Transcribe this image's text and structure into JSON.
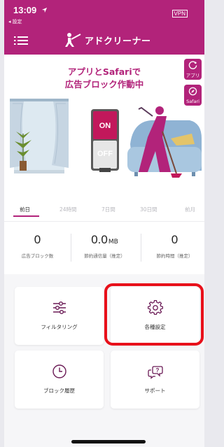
{
  "status": {
    "time": "13:09",
    "back_label": "◂ 設定",
    "vpn": "VPN"
  },
  "header": {
    "logo_text": "アドクリーナー"
  },
  "hero": {
    "headline_line1": "アプリとSafariで",
    "headline_line2": "広告ブロック作動中",
    "toggle_on": "ON",
    "toggle_off": "OFF",
    "side_buttons": [
      {
        "label": "アプリ",
        "icon": "app-icon"
      },
      {
        "label": "Safari",
        "icon": "safari-compass-icon"
      }
    ]
  },
  "tabs": [
    {
      "label": "前日",
      "active": true
    },
    {
      "label": "24時間",
      "active": false
    },
    {
      "label": "7日間",
      "active": false
    },
    {
      "label": "30日間",
      "active": false
    },
    {
      "label": "前月",
      "active": false
    }
  ],
  "stats": [
    {
      "value": "0",
      "unit": "",
      "label": "広告ブロック数"
    },
    {
      "value": "0.0",
      "unit": "MB",
      "label": "節約通信量（推定）"
    },
    {
      "value": "0",
      "unit": "",
      "label": "節約時間（推定）"
    }
  ],
  "cards": [
    {
      "label": "フィルタリング",
      "icon": "sliders-icon"
    },
    {
      "label": "各種設定",
      "icon": "gear-icon"
    },
    {
      "label": "ブロック履歴",
      "icon": "clock-icon"
    },
    {
      "label": "サポート",
      "icon": "support-chat-icon"
    }
  ],
  "colors": {
    "brand": "#b2237a",
    "highlight": "#e8101a"
  }
}
